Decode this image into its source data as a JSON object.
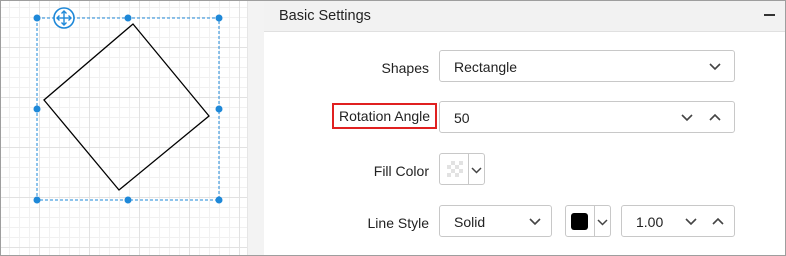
{
  "panel": {
    "title": "Basic Settings"
  },
  "fields": {
    "shapes": {
      "label": "Shapes",
      "value": "Rectangle"
    },
    "rotation": {
      "label": "Rotation Angle",
      "value": "50"
    },
    "fill_color": {
      "label": "Fill Color",
      "value": "transparent"
    },
    "line_style": {
      "label": "Line Style",
      "style_value": "Solid",
      "color": "#000000",
      "width_value": "1.00"
    }
  },
  "colors": {
    "selection": "#1e88d8",
    "highlight_border": "#e02020",
    "shape_stroke": "#000000"
  },
  "icons": [
    "move-icon",
    "chevron-down-icon",
    "chevron-up-icon",
    "collapse-icon"
  ]
}
